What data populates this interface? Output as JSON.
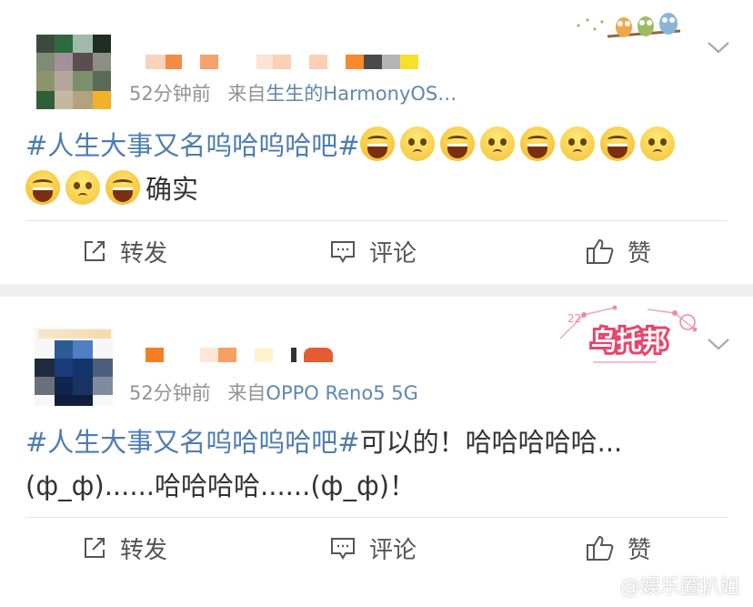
{
  "posts": [
    {
      "time": "52分钟前",
      "source_prefix": "来自",
      "source": "生生的HarmonyOS…",
      "hashtag": "#人生大事又名呜哈呜哈吧#",
      "emoji_row1": [
        "laughing-emoji",
        "sad-emoji",
        "laughing-emoji",
        "sad-emoji",
        "laughing-emoji",
        "sad-emoji",
        "laughing-emoji",
        "sad-emoji"
      ],
      "emoji_row2": [
        "laughing-emoji",
        "sad-emoji",
        "laughing-emoji"
      ],
      "trailing_text": "确实",
      "actions": {
        "repost": "转发",
        "comment": "评论",
        "like": "赞"
      }
    },
    {
      "time": "52分钟前",
      "source_prefix": "来自",
      "source": "OPPO Reno5 5G",
      "hashtag": "#人生大事又名呜哈呜哈吧#",
      "text_line1": "可以的！哈哈哈哈哈...",
      "text_line2": "(ф_ф)......哈哈哈哈......(ф_ф)！",
      "badge": "乌托邦",
      "actions": {
        "repost": "转发",
        "comment": "评论",
        "like": "赞"
      }
    }
  ],
  "watermark": "@娱乐圈扒姐",
  "colors": {
    "hashtag": "#4d7cb0",
    "source": "#5f87b0",
    "meta": "#939393",
    "badge": "#e8456b"
  }
}
